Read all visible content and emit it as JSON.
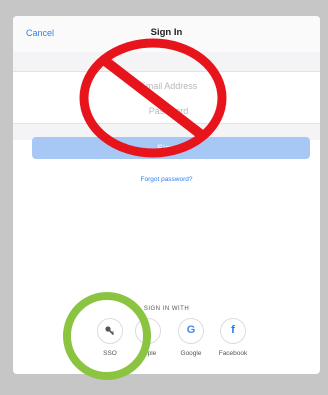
{
  "navbar": {
    "cancel_label": "Cancel",
    "title": "Sign In"
  },
  "form": {
    "email_placeholder": "Email Address",
    "password_placeholder": "Password",
    "signin_label": "Sign In",
    "forgot_label": "Forgot password?"
  },
  "providers": {
    "heading": "SIGN IN WITH",
    "items": [
      {
        "label": "SSO",
        "icon": "key-icon"
      },
      {
        "label": "Apple",
        "icon": "apple-icon"
      },
      {
        "label": "Google",
        "icon": "google-icon"
      },
      {
        "label": "Facebook",
        "icon": "facebook-icon"
      }
    ]
  },
  "colors": {
    "accent": "#2f7ef6",
    "button_disabled": "#a7c8f5",
    "prohibition_red": "#e8141c",
    "highlight_green": "#8ac440"
  }
}
